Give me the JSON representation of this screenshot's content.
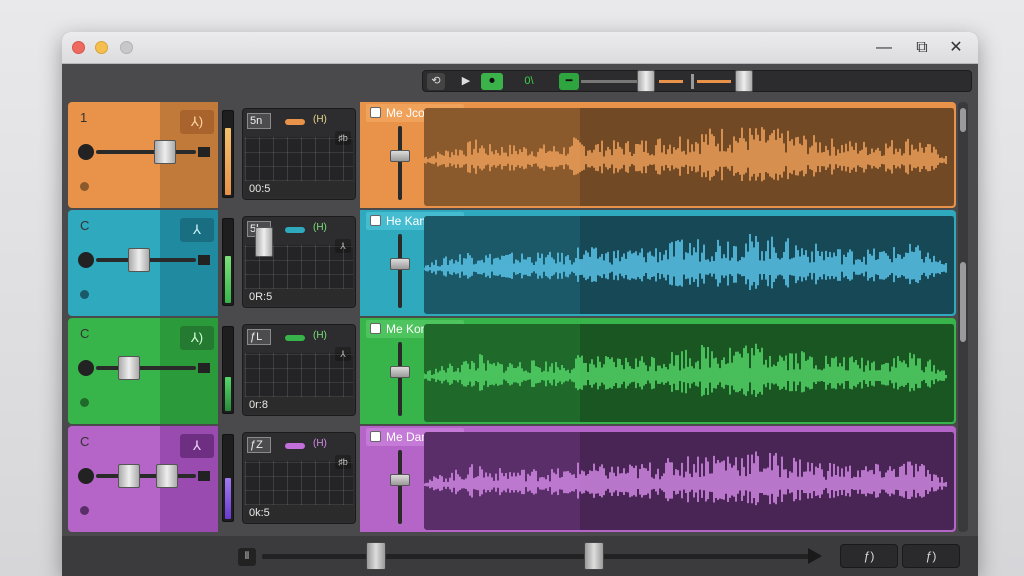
{
  "window": {
    "controls": {
      "minimize": "—",
      "maximize": "⧉",
      "close": "✕"
    }
  },
  "transport": {
    "loop_label": "⟲",
    "play_icon": "▶",
    "rec_label": "⏺",
    "counter": "0\\",
    "marker": "━"
  },
  "tracks": [
    {
      "number": "1",
      "color": "#e8924a",
      "dark": "#c27a3a",
      "wave_color": "#f0a15a",
      "region_bg": "#8a5a2c",
      "icon_label": "⅄)",
      "plugin_label": "5n",
      "plugin_tag": "(H)",
      "plugin_icon": "♯b",
      "plugin_value": "00:5",
      "region_name": "Me Jcond",
      "meter_level": 0.78
    },
    {
      "number": "C",
      "color": "#2fa9bd",
      "dark": "#1f8aa0",
      "wave_color": "#5cc8ee",
      "region_bg": "#1b5868",
      "icon_label": "⅄",
      "plugin_label": "5l",
      "plugin_tag": "(H)",
      "plugin_icon": "⅄",
      "plugin_value": "0R:5",
      "region_name": "He Kame",
      "meter_level": 0.55
    },
    {
      "number": "C",
      "color": "#38b54a",
      "dark": "#2a9a3a",
      "wave_color": "#55d96a",
      "region_bg": "#1f6a2a",
      "icon_label": "⅄)",
      "plugin_label": "ƒL",
      "plugin_tag": "(H)",
      "plugin_icon": "⅄",
      "plugin_value": "0r:8",
      "region_name": "Me Kome",
      "meter_level": 0.4
    },
    {
      "number": "C",
      "color": "#b565c8",
      "dark": "#9a4bb0",
      "wave_color": "#d58ae8",
      "region_bg": "#5a2e68",
      "icon_label": "⅄",
      "plugin_label": "ƒZ",
      "plugin_tag": "(H)",
      "plugin_icon": "♯b",
      "plugin_value": "0k:5",
      "region_name": "Me Dame",
      "meter_level": 0.48
    }
  ],
  "bottom": {
    "left_icon": "⫴",
    "right_button_1": "ƒ)",
    "right_button_2": "ƒ)"
  }
}
